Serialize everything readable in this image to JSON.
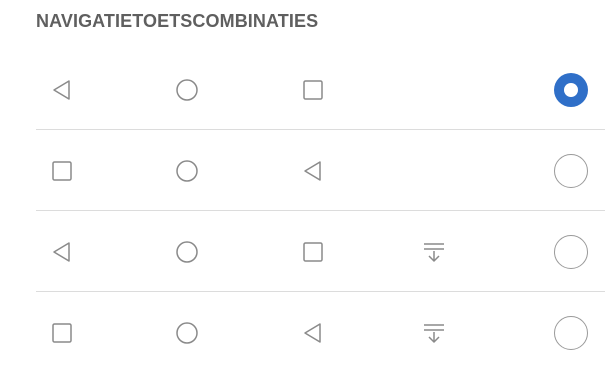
{
  "section": {
    "title": "NAVIGATIETOETSCOMBINATIES"
  },
  "colors": {
    "accent": "#2f6fc8",
    "icon": "#8a8a8a",
    "divider": "#dcdcdc",
    "title": "#5f5f5f"
  },
  "options": [
    {
      "keys": [
        "back-icon",
        "home-icon",
        "recents-icon"
      ],
      "selected": true
    },
    {
      "keys": [
        "recents-icon",
        "home-icon",
        "back-icon"
      ],
      "selected": false
    },
    {
      "keys": [
        "back-icon",
        "home-icon",
        "recents-icon",
        "notification-pulldown-icon"
      ],
      "selected": false
    },
    {
      "keys": [
        "recents-icon",
        "home-icon",
        "back-icon",
        "notification-pulldown-icon"
      ],
      "selected": false
    }
  ]
}
